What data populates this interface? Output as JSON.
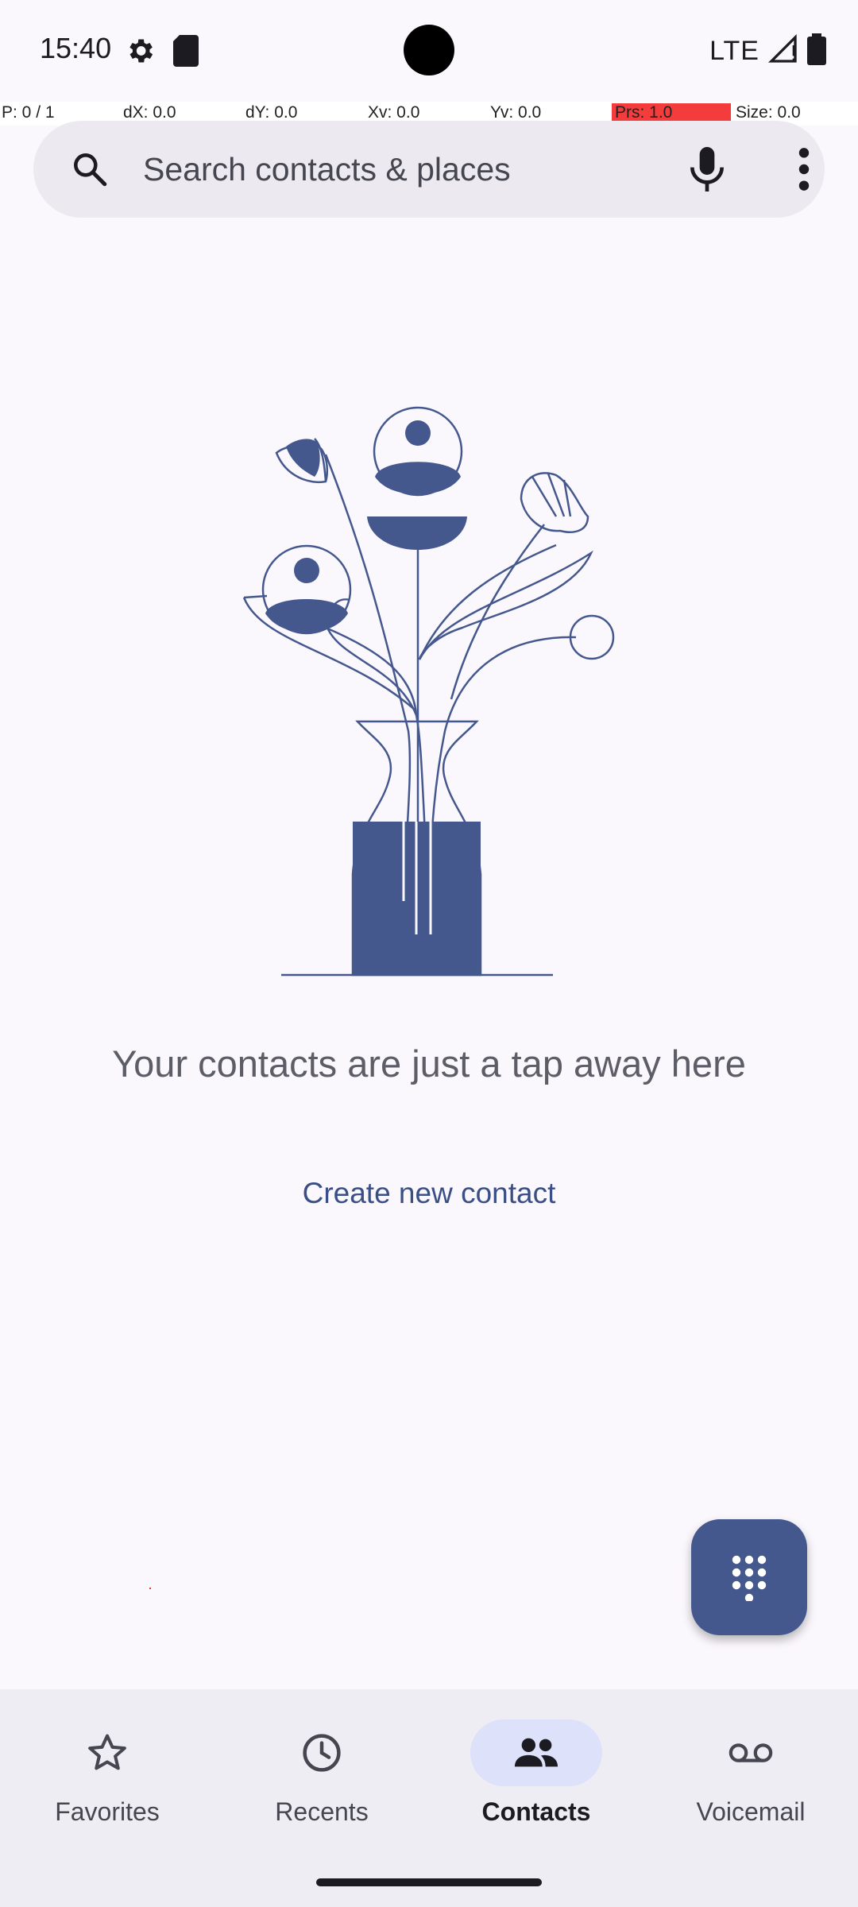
{
  "status_bar": {
    "time": "15:40",
    "network": "LTE",
    "icons": [
      "settings-icon",
      "sd-card-icon",
      "signal-icon",
      "battery-icon"
    ]
  },
  "debug_overlay": {
    "pointer": "P: 0 / 1",
    "dx": "dX: 0.0",
    "dy": "dY: 0.0",
    "xv": "Xv: 0.0",
    "yv": "Yv: 0.0",
    "prs": "Prs: 1.0",
    "size": "Size: 0.0"
  },
  "search": {
    "placeholder": "Search contacts & places",
    "value": ""
  },
  "empty_state": {
    "message": "Your contacts are just a tap away here",
    "action": "Create new contact"
  },
  "fab": {
    "icon": "dialpad-icon"
  },
  "bottom_nav": {
    "items": [
      {
        "label": "Favorites",
        "icon": "star-icon",
        "active": false
      },
      {
        "label": "Recents",
        "icon": "clock-icon",
        "active": false
      },
      {
        "label": "Contacts",
        "icon": "people-icon",
        "active": true
      },
      {
        "label": "Voicemail",
        "icon": "voicemail-icon",
        "active": false
      }
    ]
  },
  "colors": {
    "background": "#fbf8fd",
    "accent": "#44588e",
    "nav_active_pill": "#dde1f9",
    "search_bg": "#ece9f1"
  }
}
